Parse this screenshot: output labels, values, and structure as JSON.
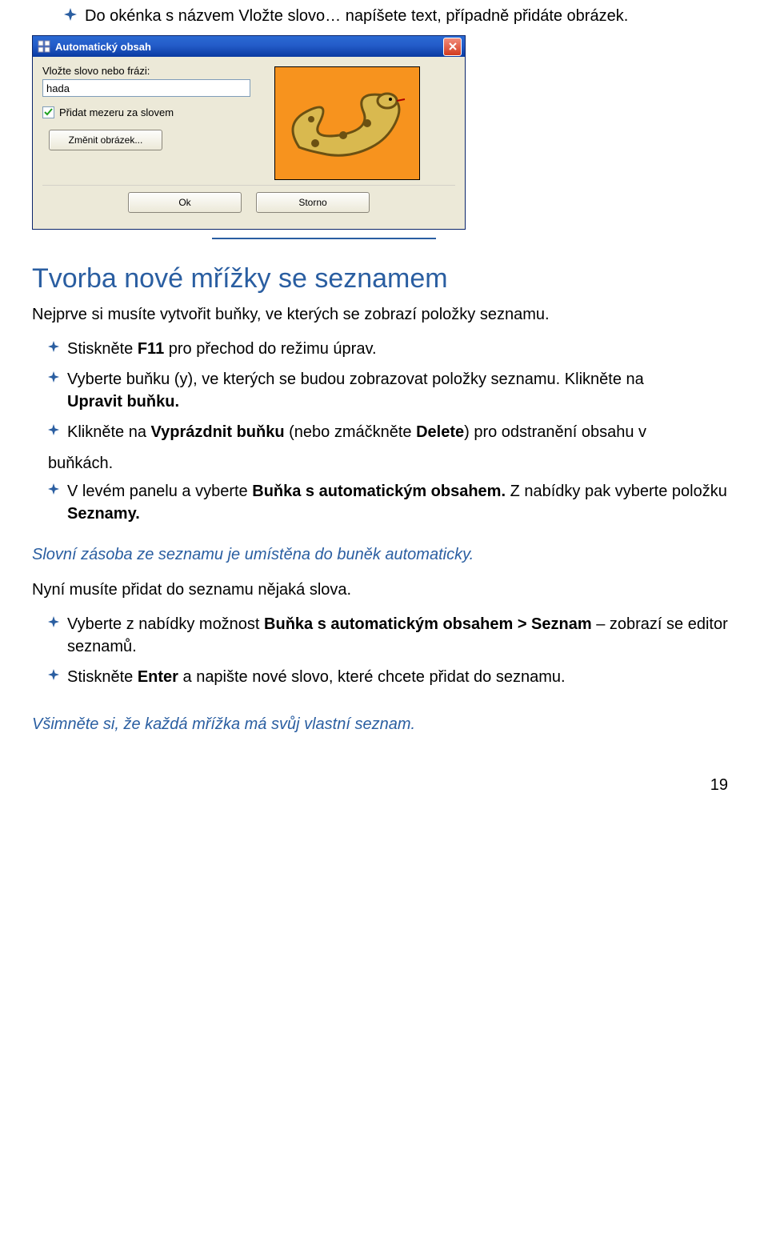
{
  "intro_bullet": "Do okénka s názvem Vložte slovo… napíšete text, případně přidáte obrázek.",
  "dialog": {
    "title": "Automatický obsah",
    "field_label": "Vložte slovo nebo frázi:",
    "input_value": "hada ",
    "checkbox_label": "Přidat mezeru za slovem",
    "change_image_btn": "Změnit obrázek...",
    "ok_btn": "Ok",
    "cancel_btn": "Storno"
  },
  "heading": "Tvorba nové mřížky se seznamem",
  "para_intro": "Nejprve si musíte vytvořit buňky, ve kterých se zobrazí položky seznamu.",
  "bullets1": [
    {
      "pre": "Stiskněte ",
      "b": "F11",
      "post": " pro přechod do režimu úprav."
    },
    {
      "pre": "Vyberte buňku (y), ve kterých se budou zobrazovat položky seznamu. Klikněte na ",
      "b": "",
      "post": ""
    },
    {
      "pre": "",
      "b": "Upravit buňku.",
      "post": ""
    }
  ],
  "bullet_vyprazdnit_pre": "Klikněte na ",
  "bullet_vyprazdnit_b1": "Vyprázdnit buňku",
  "bullet_vyprazdnit_mid": " (nebo zmáčkněte ",
  "bullet_vyprazdnit_b2": "Delete",
  "bullet_vyprazdnit_post": ") pro odstranění obsahu v",
  "bullet_vyprazdnit_line2": "buňkách.",
  "bullet_levypanel_pre": "V levém panelu a vyberte ",
  "bullet_levypanel_b1": "Buňka s automatickým obsahem.",
  "bullet_levypanel_mid": " Z nabídky pak vyberte položku ",
  "bullet_levypanel_b2": "Seznamy.",
  "italic1": "Slovní zásoba ze seznamu je umístěna do buněk automaticky.",
  "para_nyni": "Nyní musíte přidat do seznamu nějaká slova.",
  "bullet_vyberte_pre": "Vyberte z nabídky možnost ",
  "bullet_vyberte_b": "Buňka s automatickým obsahem > Seznam",
  "bullet_vyberte_post": " – zobrazí se editor seznamů.",
  "bullet_enter_pre": "Stiskněte ",
  "bullet_enter_b": "Enter",
  "bullet_enter_post": " a napište nové slovo, které chcete přidat do seznamu.",
  "italic2": "Všimněte si, že každá mřížka má svůj vlastní seznam.",
  "page_number": "19"
}
